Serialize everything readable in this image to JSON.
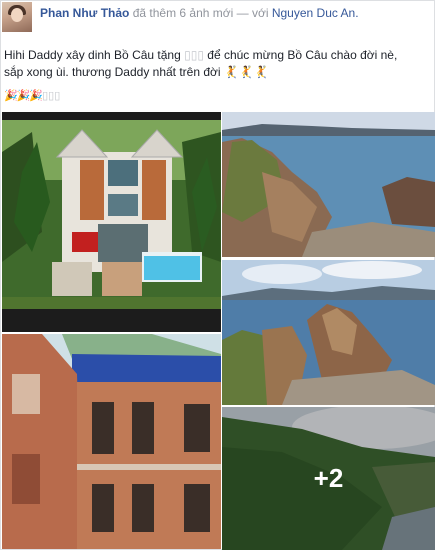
{
  "post": {
    "author": "Phan Như Thảo",
    "action": "đã thêm 6 ảnh mới — với",
    "tagged": "Nguyen Duc An.",
    "line1": "Hihi Daddy xây dinh Bồ Câu tặng",
    "line1_boxes": "▯▯▯",
    "line1_end": "để chúc mừng Bồ Câu chào đời nè,",
    "line2": "sắp xong ùi. thương Daddy nhất trên đời",
    "line2_end": "🤾🤾🤾",
    "emoji_row": "🎉🎉🎉",
    "emoji_row_boxes": "▯▯▯"
  },
  "gallery": {
    "photos": [
      {
        "name": "house-3d-render"
      },
      {
        "name": "coastal-cliff-1"
      },
      {
        "name": "coastal-cliff-2"
      },
      {
        "name": "house-under-construction"
      },
      {
        "name": "hillside-sea"
      }
    ],
    "more_count": "+2"
  }
}
